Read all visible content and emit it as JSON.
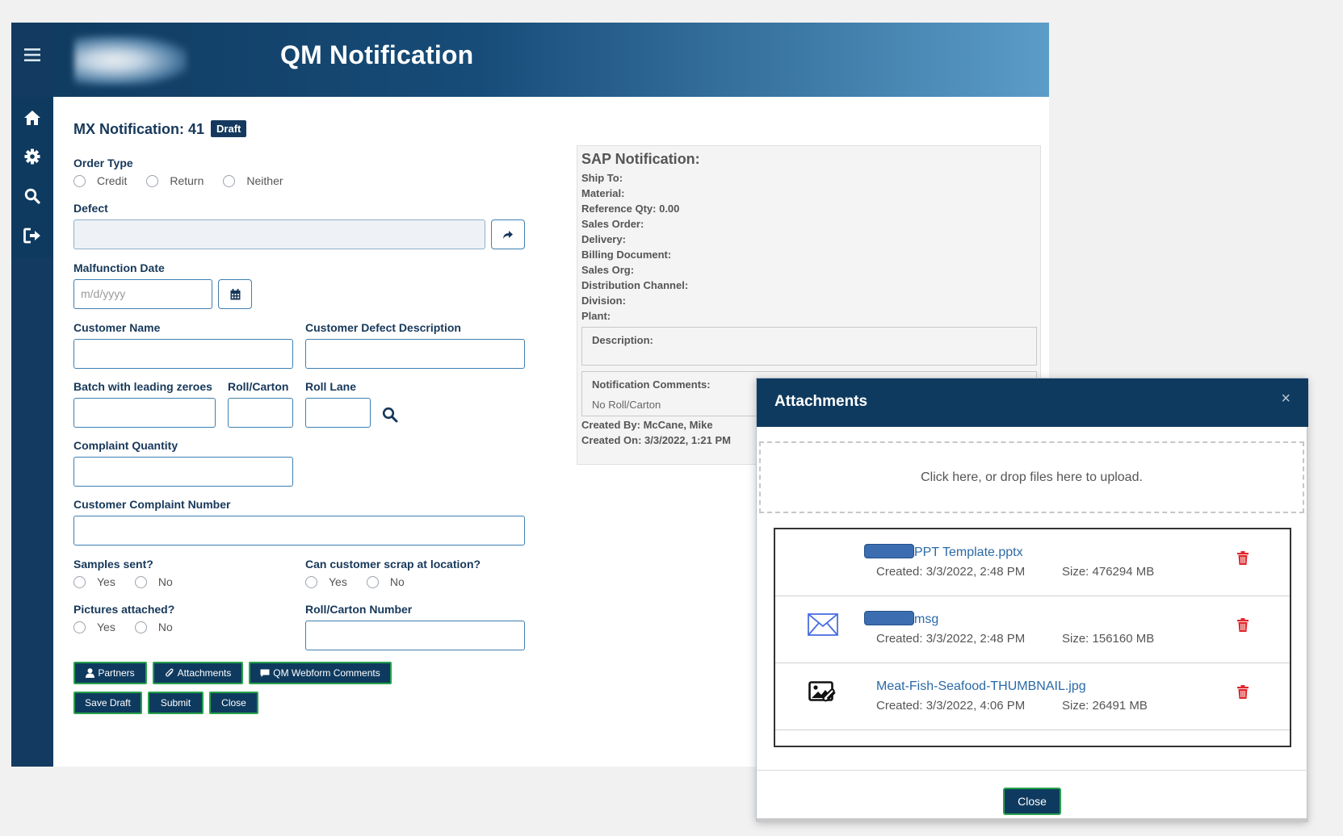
{
  "app": {
    "title": "QM Notification"
  },
  "form": {
    "title": "MX Notification: 41",
    "status": "Draft",
    "order_type": {
      "label": "Order Type",
      "options": [
        "Credit",
        "Return",
        "Neither"
      ]
    },
    "defect": {
      "label": "Defect"
    },
    "malfunction_date": {
      "label": "Malfunction Date",
      "placeholder": "m/d/yyyy"
    },
    "customer_name": {
      "label": "Customer Name"
    },
    "customer_defect_description": {
      "label": "Customer Defect Description"
    },
    "batch": {
      "label": "Batch with leading zeroes"
    },
    "roll_carton": {
      "label": "Roll/Carton"
    },
    "roll_lane": {
      "label": "Roll Lane"
    },
    "complaint_quantity": {
      "label": "Complaint Quantity"
    },
    "customer_complaint_number": {
      "label": "Customer Complaint Number"
    },
    "samples_sent": {
      "label": "Samples sent?",
      "yes": "Yes",
      "no": "No"
    },
    "can_scrap": {
      "label": "Can customer scrap at location?",
      "yes": "Yes",
      "no": "No"
    },
    "pictures_attached": {
      "label": "Pictures attached?",
      "yes": "Yes",
      "no": "No"
    },
    "roll_carton_number": {
      "label": "Roll/Carton Number"
    },
    "buttons": {
      "partners": "Partners",
      "attachments": "Attachments",
      "webform_comments": "QM Webform Comments",
      "save_draft": "Save Draft",
      "submit": "Submit",
      "close": "Close"
    }
  },
  "sap": {
    "title": "SAP Notification:",
    "lines": [
      "Ship To:",
      "Material:",
      "Reference Qty: 0.00",
      "Sales Order:",
      "Delivery:",
      "Billing Document:",
      "Sales Org:",
      "Distribution Channel:",
      "Division:",
      "Plant:"
    ],
    "description_label": "Description:",
    "comments_label": "Notification Comments:",
    "comments_text": "No Roll/Carton",
    "created_by": "Created By: McCane, Mike",
    "created_on": "Created On: 3/3/2022, 1:21 PM"
  },
  "modal": {
    "title": "Attachments",
    "close_x": "×",
    "dropzone_text": "Click here, or drop files here to upload.",
    "files": [
      {
        "name": "PPT Template.pptx",
        "created": "Created: 3/3/2022, 2:48 PM",
        "size": "Size: 476294 MB",
        "icon": "none"
      },
      {
        "name": "msg",
        "created": "Created: 3/3/2022, 2:48 PM",
        "size": "Size: 156160 MB",
        "icon": "envelope-icon"
      },
      {
        "name": "Meat-Fish-Seafood-THUMBNAIL.jpg",
        "created": "Created: 3/3/2022, 4:06 PM",
        "size": "Size: 26491 MB",
        "icon": "image-attachment-icon"
      }
    ],
    "close_label": "Close"
  },
  "colors": {
    "primary": "#0f3a5f",
    "accent_border": "#27a24a",
    "danger": "#e0262b"
  }
}
